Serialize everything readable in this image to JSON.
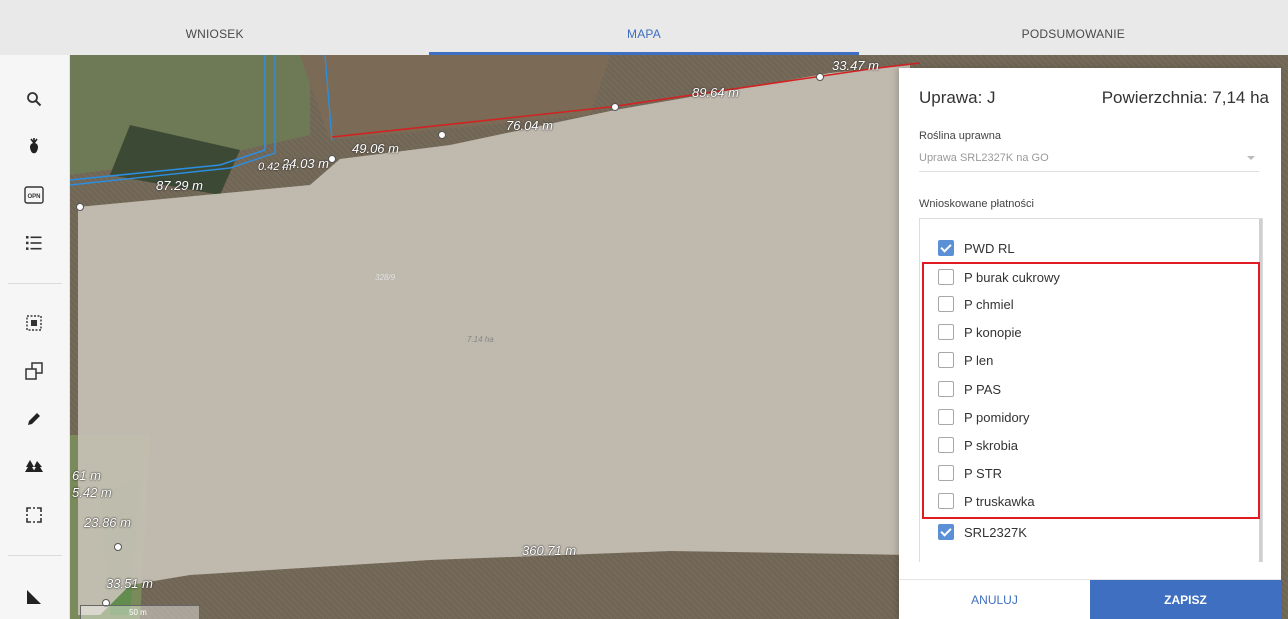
{
  "tabs": [
    {
      "label": "WNIOSEK",
      "active": false
    },
    {
      "label": "MAPA",
      "active": true
    },
    {
      "label": "PODSUMOWANIE",
      "active": false
    }
  ],
  "toolbar": {
    "icons": [
      "search-icon",
      "plant-icon",
      "opn-icon",
      "list-icon",
      "select-area-icon",
      "copy-icon",
      "pencil-icon",
      "trees-icon",
      "bounding-box-icon",
      "measure-icon"
    ],
    "opn_text": "OPN"
  },
  "map": {
    "labels": {
      "l1": "89.64 m",
      "l2": "76.04 m",
      "l3": "49.06 m",
      "l4": "24.03 m",
      "l5": "0.42 m",
      "l6": "87.29 m",
      "l7": "33.47 m",
      "l8": "328/9",
      "l9": "7.14 ha",
      "l10": "360.71 m",
      "l11": "61 m",
      "l12": "5.42 m",
      "l13": "23.86 m",
      "l14": "33.51 m"
    },
    "scale": "50 m"
  },
  "panel": {
    "title": "Uprawa: J",
    "area": "Powierzchnia: 7,14 ha",
    "crop_label": "Roślina uprawna",
    "crop_value": "Uprawa SRL2327K na GO",
    "payments_label": "Wnioskowane płatności",
    "payments": [
      {
        "label": "PWD RL",
        "checked": true
      },
      {
        "label": "P burak cukrowy",
        "checked": false
      },
      {
        "label": "P chmiel",
        "checked": false
      },
      {
        "label": "P konopie",
        "checked": false
      },
      {
        "label": "P len",
        "checked": false
      },
      {
        "label": "P PAS",
        "checked": false
      },
      {
        "label": "P pomidory",
        "checked": false
      },
      {
        "label": "P skrobia",
        "checked": false
      },
      {
        "label": "P STR",
        "checked": false
      },
      {
        "label": "P truskawka",
        "checked": false
      },
      {
        "label": "SRL2327K",
        "checked": true
      }
    ],
    "cancel": "ANULUJ",
    "save": "ZAPISZ"
  },
  "colors": {
    "accent": "#3f6fc0",
    "highlight": "#e01b24",
    "checkbox_checked": "#5b8fd6"
  }
}
